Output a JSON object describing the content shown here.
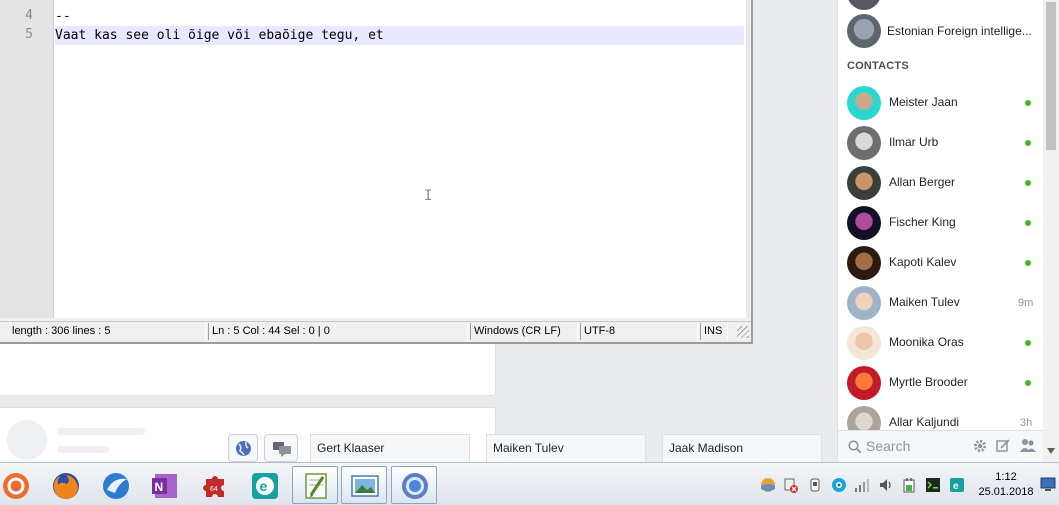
{
  "editor": {
    "lines": [
      {
        "number": "4",
        "text": "--"
      },
      {
        "number": "5",
        "text": "Vaat kas see oli õige või ebaõige tegu, et"
      }
    ],
    "caret_glyph": "I",
    "status": {
      "length": "length : 306    lines : 5",
      "position": "Ln : 5    Col : 44    Sel : 0 | 0",
      "eol": "Windows (CR LF)",
      "encoding": "UTF-8",
      "mode": "INS"
    }
  },
  "chat": {
    "group_name": "Estonian Foreign intellige...",
    "contacts_heading": "CONTACTS",
    "contacts": [
      {
        "name": "Meister Jaan",
        "status": "online"
      },
      {
        "name": "Ilmar Urb",
        "status": "online"
      },
      {
        "name": "Allan Berger",
        "status": "online"
      },
      {
        "name": "Fischer King",
        "status": "online"
      },
      {
        "name": "Kapoti Kalev",
        "status": "online"
      },
      {
        "name": "Maiken Tulev",
        "status": "9m"
      },
      {
        "name": "Moonika Oras",
        "status": "online"
      },
      {
        "name": "Myrtle Brooder",
        "status": "online"
      },
      {
        "name": "Allar Kaljundi",
        "status": "3h"
      }
    ],
    "search_placeholder": "Search",
    "tabs": [
      "Gert Klaaser",
      "Maiken Tulev",
      "Jaak Madison"
    ]
  },
  "taskbar": {
    "apps": [
      "avast-icon",
      "firefox-icon",
      "thunderbird-icon",
      "onenote-icon",
      "puzzle64-icon",
      "eset-icon",
      "notepadplusplus-icon",
      "photo-viewer-icon",
      "chrome-icon"
    ],
    "active_app": "notepadplusplus-icon",
    "clock_time": "1:12",
    "clock_date": "25.01.2018"
  },
  "colors": {
    "online": "#42b72a",
    "accent": "#4267b2"
  }
}
